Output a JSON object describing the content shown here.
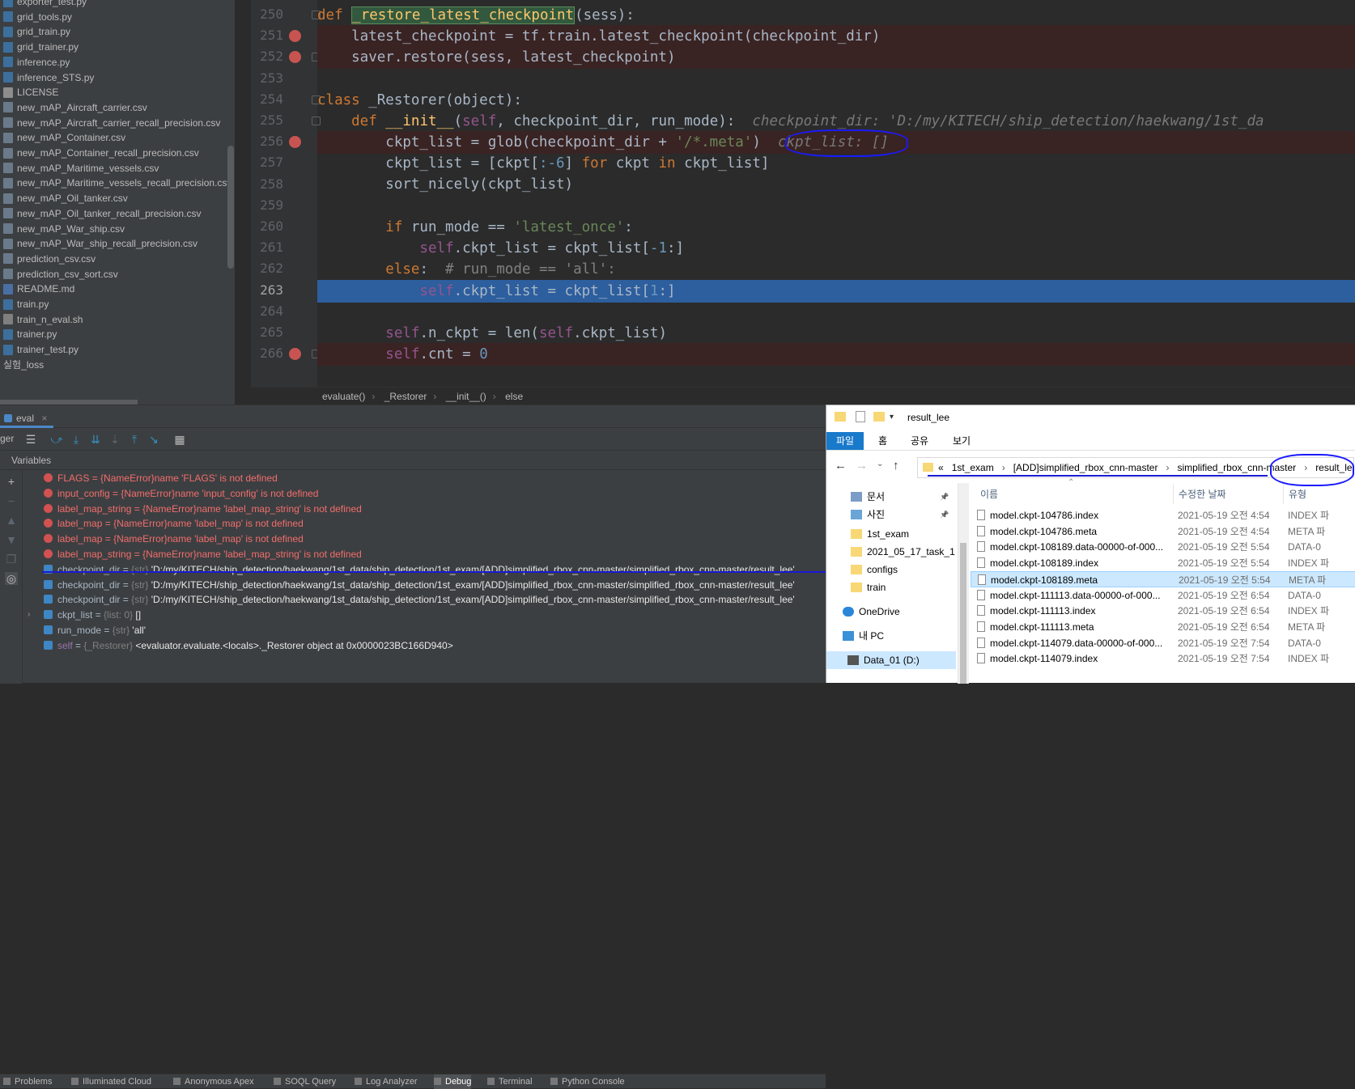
{
  "project_tree": {
    "items": [
      {
        "name": "exporter_test.py",
        "kind": "py"
      },
      {
        "name": "grid_tools.py",
        "kind": "py"
      },
      {
        "name": "grid_train.py",
        "kind": "py"
      },
      {
        "name": "grid_trainer.py",
        "kind": "py"
      },
      {
        "name": "inference.py",
        "kind": "py"
      },
      {
        "name": "inference_STS.py",
        "kind": "py"
      },
      {
        "name": "LICENSE",
        "kind": "txt"
      },
      {
        "name": "new_mAP_Aircraft_carrier.csv",
        "kind": "csv"
      },
      {
        "name": "new_mAP_Aircraft_carrier_recall_precision.csv",
        "kind": "csv"
      },
      {
        "name": "new_mAP_Container.csv",
        "kind": "csv"
      },
      {
        "name": "new_mAP_Container_recall_precision.csv",
        "kind": "csv"
      },
      {
        "name": "new_mAP_Maritime_vessels.csv",
        "kind": "csv"
      },
      {
        "name": "new_mAP_Maritime_vessels_recall_precision.csv",
        "kind": "csv"
      },
      {
        "name": "new_mAP_Oil_tanker.csv",
        "kind": "csv"
      },
      {
        "name": "new_mAP_Oil_tanker_recall_precision.csv",
        "kind": "csv"
      },
      {
        "name": "new_mAP_War_ship.csv",
        "kind": "csv"
      },
      {
        "name": "new_mAP_War_ship_recall_precision.csv",
        "kind": "csv"
      },
      {
        "name": "prediction_csv.csv",
        "kind": "csv"
      },
      {
        "name": "prediction_csv_sort.csv",
        "kind": "csv"
      },
      {
        "name": "README.md",
        "kind": "md"
      },
      {
        "name": "train.py",
        "kind": "py"
      },
      {
        "name": "train_n_eval.sh",
        "kind": "sh"
      },
      {
        "name": "trainer.py",
        "kind": "py"
      },
      {
        "name": "trainer_test.py",
        "kind": "py"
      },
      {
        "name": "실험_loss",
        "kind": "none"
      }
    ]
  },
  "editor": {
    "lines": [
      {
        "no": "250"
      },
      {
        "no": "251"
      },
      {
        "no": "252"
      },
      {
        "no": "253"
      },
      {
        "no": "254"
      },
      {
        "no": "255"
      },
      {
        "no": "256"
      },
      {
        "no": "257"
      },
      {
        "no": "258"
      },
      {
        "no": "259"
      },
      {
        "no": "260"
      },
      {
        "no": "261"
      },
      {
        "no": "262"
      },
      {
        "no": "263"
      },
      {
        "no": "264"
      },
      {
        "no": "265"
      },
      {
        "no": "266"
      }
    ],
    "code": {
      "l250_def": "def ",
      "l250_fn": "_restore_latest_checkpoint",
      "l250_rest": "(sess):",
      "l251": "    latest_checkpoint = tf.train.latest_checkpoint(checkpoint_dir)",
      "l252": "    saver.restore(sess, latest_checkpoint)",
      "l254_kw": "class ",
      "l254_rest": "_Restorer(object):",
      "l255_def": "    def ",
      "l255_fn": "__init__",
      "l255_p1": "(",
      "l255_self": "self",
      "l255_rest": ", checkpoint_dir, run_mode):",
      "l255_hint": "  checkpoint_dir: 'D:/my/KITECH/ship_detection/haekwang/1st_da",
      "l256_a": "        ckpt_list = glob(checkpoint_dir + ",
      "l256_str": "'/*.meta'",
      "l256_b": ")",
      "l256_hint": "  ckpt_list: []",
      "l257_a": "        ckpt_list = [ckpt[",
      "l257_num": ":-6",
      "l257_b": "] ",
      "l257_for": "for",
      "l257_c": " ckpt ",
      "l257_in": "in",
      "l257_d": " ckpt_list]",
      "l258": "        sort_nicely(ckpt_list)",
      "l260_if": "        if",
      "l260_a": " run_mode == ",
      "l260_str": "'latest_once'",
      "l260_b": ":",
      "l261_self": "            self",
      "l261_a": ".ckpt_list = ckpt_list[",
      "l261_num": "-1",
      "l261_b": ":]",
      "l262_else": "        else",
      "l262_a": ":  ",
      "l262_cm": "# run_mode == 'all':",
      "l263_self": "            self",
      "l263_a": ".ckpt_list = ckpt_list[",
      "l263_num": "1",
      "l263_b": ":]",
      "l265_self": "        self",
      "l265_a": ".n_ckpt = len(",
      "l265_self2": "self",
      "l265_b": ".ckpt_list)",
      "l266_self": "        self",
      "l266_a": ".cnt = ",
      "l266_num": "0"
    },
    "breadcrumbs": [
      "evaluate()",
      "_Restorer",
      "__init__()",
      "else"
    ]
  },
  "debug": {
    "tab_label": "eval",
    "toolbar_left_label": "ger",
    "variables_header": "Variables",
    "variables": [
      {
        "kind": "err",
        "name": "FLAGS",
        "eq": " = ",
        "val": "{NameError}name 'FLAGS' is not defined"
      },
      {
        "kind": "err",
        "name": "input_config",
        "eq": " = ",
        "val": "{NameError}name 'input_config' is not defined"
      },
      {
        "kind": "err",
        "name": "label_map_string",
        "eq": " = ",
        "val": "{NameError}name 'label_map_string' is not defined"
      },
      {
        "kind": "err",
        "name": "label_map",
        "eq": " = ",
        "val": "{NameError}name 'label_map' is not defined"
      },
      {
        "kind": "err",
        "name": "label_map",
        "eq": " = ",
        "val": "{NameError}name 'label_map' is not defined"
      },
      {
        "kind": "err",
        "name": "label_map_string",
        "eq": " = ",
        "val": "{NameError}name 'label_map_string' is not defined"
      },
      {
        "kind": "var",
        "name": "checkpoint_dir",
        "eq": " = ",
        "type": "{str} ",
        "val": "'D:/my/KITECH/ship_detection/haekwang/1st_data/ship_detection/1st_exam/[ADD]simplified_rbox_cnn-master/simplified_rbox_cnn-master/result_lee'"
      },
      {
        "kind": "var",
        "name": "checkpoint_dir",
        "eq": " = ",
        "type": "{str} ",
        "val": "'D:/my/KITECH/ship_detection/haekwang/1st_data/ship_detection/1st_exam/[ADD]simplified_rbox_cnn-master/simplified_rbox_cnn-master/result_lee'"
      },
      {
        "kind": "var",
        "name": "checkpoint_dir",
        "eq": " = ",
        "type": "{str} ",
        "val": "'D:/my/KITECH/ship_detection/haekwang/1st_data/ship_detection/1st_exam/[ADD]simplified_rbox_cnn-master/simplified_rbox_cnn-master/result_lee'"
      },
      {
        "kind": "var",
        "name": "ckpt_list",
        "eq": " = ",
        "type": "{list: 0} ",
        "val": "[]"
      },
      {
        "kind": "var",
        "name": "run_mode",
        "eq": " = ",
        "type": "{str} ",
        "val": "'all'"
      },
      {
        "kind": "var",
        "name": "self",
        "eq": " = ",
        "type": "{_Restorer} ",
        "val": "<evaluator.evaluate.<locals>._Restorer object at 0x0000023BC166D940>"
      }
    ],
    "bottom_tabs": [
      "Problems",
      "Illuminated Cloud",
      "Anonymous Apex",
      "SOQL Query",
      "Log Analyzer",
      "Debug",
      "Terminal",
      "Python Console"
    ]
  },
  "explorer": {
    "title": "result_lee",
    "ribbon_tabs": [
      "파일",
      "홈",
      "공유",
      "보기"
    ],
    "address": {
      "prefix": "«",
      "parts": [
        "1st_exam",
        "[ADD]simplified_rbox_cnn-master",
        "simplified_rbox_cnn-master",
        "result_lee"
      ]
    },
    "nav": [
      {
        "label": "문서",
        "type": "docs",
        "pinned": true
      },
      {
        "label": "사진",
        "type": "pics",
        "pinned": true
      },
      {
        "label": "1st_exam",
        "type": "folder"
      },
      {
        "label": "2021_05_17_task_1",
        "type": "folder"
      },
      {
        "label": "configs",
        "type": "folder"
      },
      {
        "label": "train",
        "type": "folder"
      },
      {
        "label": "OneDrive",
        "type": "cloud"
      },
      {
        "label": "내 PC",
        "type": "pc"
      },
      {
        "label": "Data_01 (D:)",
        "type": "drive",
        "selected": true
      }
    ],
    "columns": {
      "name": "이름",
      "date": "수정한 날짜",
      "type": "유형"
    },
    "files": [
      {
        "name": "model.ckpt-104786.index",
        "date": "2021-05-19 오전 4:54",
        "type": "INDEX 파"
      },
      {
        "name": "model.ckpt-104786.meta",
        "date": "2021-05-19 오전 4:54",
        "type": "META 파"
      },
      {
        "name": "model.ckpt-108189.data-00000-of-000...",
        "date": "2021-05-19 오전 5:54",
        "type": "DATA-0"
      },
      {
        "name": "model.ckpt-108189.index",
        "date": "2021-05-19 오전 5:54",
        "type": "INDEX 파"
      },
      {
        "name": "model.ckpt-108189.meta",
        "date": "2021-05-19 오전 5:54",
        "type": "META 파",
        "selected": true
      },
      {
        "name": "model.ckpt-111113.data-00000-of-000...",
        "date": "2021-05-19 오전 6:54",
        "type": "DATA-0"
      },
      {
        "name": "model.ckpt-111113.index",
        "date": "2021-05-19 오전 6:54",
        "type": "INDEX 파"
      },
      {
        "name": "model.ckpt-111113.meta",
        "date": "2021-05-19 오전 6:54",
        "type": "META 파"
      },
      {
        "name": "model.ckpt-114079.data-00000-of-000...",
        "date": "2021-05-19 오전 7:54",
        "type": "DATA-0"
      },
      {
        "name": "model.ckpt-114079.index",
        "date": "2021-05-19 오전 7:54",
        "type": "INDEX 파"
      }
    ]
  }
}
